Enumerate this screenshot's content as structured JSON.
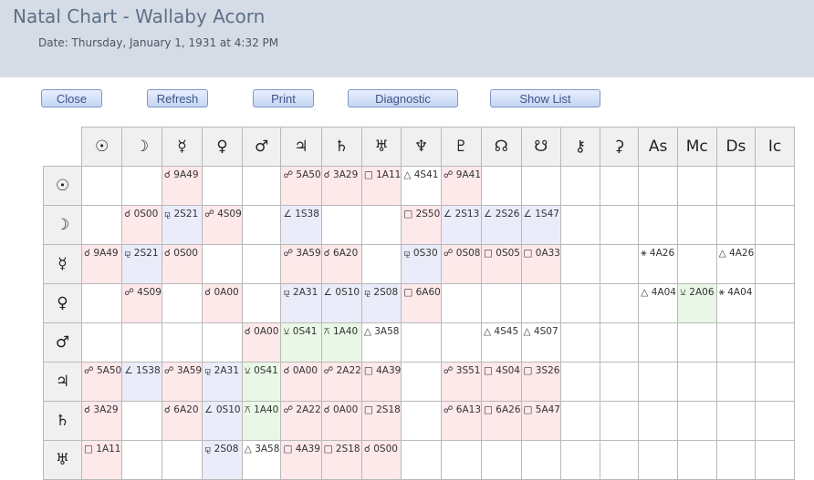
{
  "header": {
    "title": "Natal Chart - Wallaby Acorn",
    "date": "Date: Thursday, January 1, 1931 at 4:32 PM"
  },
  "buttons": {
    "close": "Close",
    "refresh": "Refresh",
    "print": "Print",
    "diagnostic": "Diagnostic",
    "show_list": "Show List"
  },
  "grid": {
    "columns": [
      "☉",
      "☽",
      "☿",
      "♀",
      "♂",
      "♃",
      "♄",
      "♅",
      "♆",
      "♇",
      "☊",
      "☋",
      "⚷",
      "⚳",
      "As",
      "Mc",
      "Ds",
      "Ic"
    ],
    "rows": [
      {
        "symbol": "☉",
        "cells": [
          [
            "",
            ""
          ],
          [
            "",
            ""
          ],
          [
            "☌ 9A49",
            "pink"
          ],
          [
            "",
            ""
          ],
          [
            "",
            ""
          ],
          [
            "☍ 5A50",
            "pink"
          ],
          [
            "☌ 3A29",
            "pink"
          ],
          [
            "□ 1A11",
            "pink"
          ],
          [
            "△ 4S41",
            "plain"
          ],
          [
            "☍ 9A41",
            "pink"
          ],
          [
            "",
            ""
          ],
          [
            "",
            ""
          ],
          [
            "",
            ""
          ],
          [
            "",
            ""
          ],
          [
            "",
            ""
          ],
          [
            "",
            ""
          ],
          [
            "",
            ""
          ],
          [
            "",
            ""
          ]
        ]
      },
      {
        "symbol": "☽",
        "cells": [
          [
            "",
            ""
          ],
          [
            "☌ 0S00",
            "pink"
          ],
          [
            "⚼ 2S21",
            "blue"
          ],
          [
            "☍ 4S09",
            "pink"
          ],
          [
            "",
            ""
          ],
          [
            "∠ 1S38",
            "blue"
          ],
          [
            "",
            ""
          ],
          [
            "",
            ""
          ],
          [
            "□ 2S50",
            "pink"
          ],
          [
            "∠ 2S13",
            "blue"
          ],
          [
            "∠ 2S26",
            "blue"
          ],
          [
            "∠ 1S47",
            "blue"
          ],
          [
            "",
            ""
          ],
          [
            "",
            ""
          ],
          [
            "",
            ""
          ],
          [
            "",
            ""
          ],
          [
            "",
            ""
          ],
          [
            "",
            ""
          ]
        ]
      },
      {
        "symbol": "☿",
        "cells": [
          [
            "☌ 9A49",
            "pink"
          ],
          [
            "⚼ 2S21",
            "blue"
          ],
          [
            "☌ 0S00",
            "pink"
          ],
          [
            "",
            ""
          ],
          [
            "",
            ""
          ],
          [
            "☍ 3A59",
            "pink"
          ],
          [
            "☌ 6A20",
            "pink"
          ],
          [
            "",
            ""
          ],
          [
            "⚼ 0S30",
            "blue"
          ],
          [
            "☍ 0S08",
            "pink"
          ],
          [
            "□ 0S05",
            "pink"
          ],
          [
            "□ 0A33",
            "pink"
          ],
          [
            "",
            ""
          ],
          [
            "",
            ""
          ],
          [
            "⚹ 4A26",
            "plain"
          ],
          [
            "",
            ""
          ],
          [
            "△ 4A26",
            "plain"
          ],
          [
            "",
            ""
          ]
        ]
      },
      {
        "symbol": "♀",
        "cells": [
          [
            "",
            ""
          ],
          [
            "☍ 4S09",
            "pink"
          ],
          [
            "",
            ""
          ],
          [
            "☌ 0A00",
            "pink"
          ],
          [
            "",
            ""
          ],
          [
            "⚼ 2A31",
            "blue"
          ],
          [
            "∠ 0S10",
            "blue"
          ],
          [
            "⚼ 2S08",
            "blue"
          ],
          [
            "□ 6A60",
            "pink"
          ],
          [
            "",
            ""
          ],
          [
            "",
            ""
          ],
          [
            "",
            ""
          ],
          [
            "",
            ""
          ],
          [
            "",
            ""
          ],
          [
            "△ 4A04",
            "plain"
          ],
          [
            "⚺ 2A06",
            "green"
          ],
          [
            "⚹ 4A04",
            "plain"
          ],
          [
            "",
            ""
          ]
        ]
      },
      {
        "symbol": "♂",
        "cells": [
          [
            "",
            ""
          ],
          [
            "",
            ""
          ],
          [
            "",
            ""
          ],
          [
            "",
            ""
          ],
          [
            "☌ 0A00",
            "pink"
          ],
          [
            "⚺ 0S41",
            "green"
          ],
          [
            "⚻ 1A40",
            "green"
          ],
          [
            "△ 3A58",
            "plain"
          ],
          [
            "",
            ""
          ],
          [
            "",
            ""
          ],
          [
            "△ 4S45",
            "plain"
          ],
          [
            "△ 4S07",
            "plain"
          ],
          [
            "",
            ""
          ],
          [
            "",
            ""
          ],
          [
            "",
            ""
          ],
          [
            "",
            ""
          ],
          [
            "",
            ""
          ],
          [
            "",
            ""
          ]
        ]
      },
      {
        "symbol": "♃",
        "cells": [
          [
            "☍ 5A50",
            "pink"
          ],
          [
            "∠ 1S38",
            "blue"
          ],
          [
            "☍ 3A59",
            "pink"
          ],
          [
            "⚼ 2A31",
            "blue"
          ],
          [
            "⚺ 0S41",
            "green"
          ],
          [
            "☌ 0A00",
            "pink"
          ],
          [
            "☍ 2A22",
            "pink"
          ],
          [
            "□ 4A39",
            "pink"
          ],
          [
            "",
            ""
          ],
          [
            "☍ 3S51",
            "pink"
          ],
          [
            "□ 4S04",
            "pink"
          ],
          [
            "□ 3S26",
            "pink"
          ],
          [
            "",
            ""
          ],
          [
            "",
            ""
          ],
          [
            "",
            ""
          ],
          [
            "",
            ""
          ],
          [
            "",
            ""
          ],
          [
            "",
            ""
          ]
        ]
      },
      {
        "symbol": "♄",
        "cells": [
          [
            "☌ 3A29",
            "pink"
          ],
          [
            "",
            ""
          ],
          [
            "☌ 6A20",
            "pink"
          ],
          [
            "∠ 0S10",
            "blue"
          ],
          [
            "⚻ 1A40",
            "green"
          ],
          [
            "☍ 2A22",
            "pink"
          ],
          [
            "☌ 0A00",
            "pink"
          ],
          [
            "□ 2S18",
            "pink"
          ],
          [
            "",
            ""
          ],
          [
            "☍ 6A13",
            "pink"
          ],
          [
            "□ 6A26",
            "pink"
          ],
          [
            "□ 5A47",
            "pink"
          ],
          [
            "",
            ""
          ],
          [
            "",
            ""
          ],
          [
            "",
            ""
          ],
          [
            "",
            ""
          ],
          [
            "",
            ""
          ],
          [
            "",
            ""
          ]
        ]
      },
      {
        "symbol": "♅",
        "cells": [
          [
            "□ 1A11",
            "pink"
          ],
          [
            "",
            ""
          ],
          [
            "",
            ""
          ],
          [
            "⚼ 2S08",
            "blue"
          ],
          [
            "△ 3A58",
            "plain"
          ],
          [
            "□ 4A39",
            "pink"
          ],
          [
            "□ 2S18",
            "pink"
          ],
          [
            "☌ 0S00",
            "pink"
          ],
          [
            "",
            ""
          ],
          [
            "",
            ""
          ],
          [
            "",
            ""
          ],
          [
            "",
            ""
          ],
          [
            "",
            ""
          ],
          [
            "",
            ""
          ],
          [
            "",
            ""
          ],
          [
            "",
            ""
          ],
          [
            "",
            ""
          ],
          [
            "",
            ""
          ]
        ]
      }
    ]
  }
}
